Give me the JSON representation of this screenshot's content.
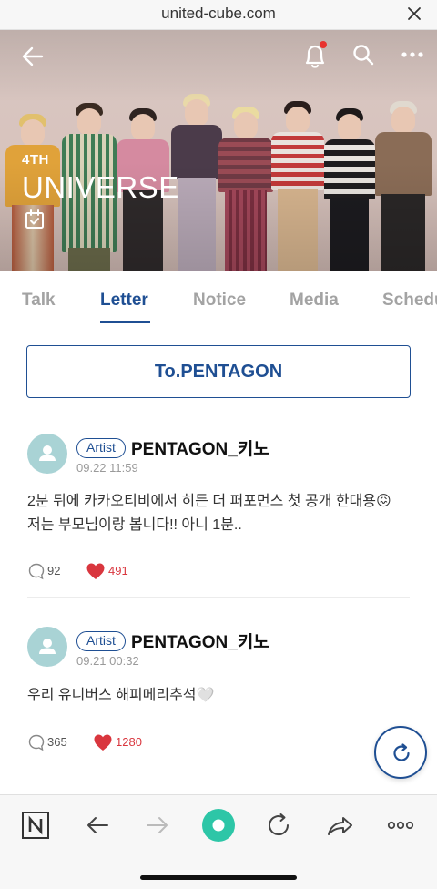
{
  "browser": {
    "url": "united-cube.com"
  },
  "hero": {
    "subtitle": "4TH",
    "title": "UNIVERSE"
  },
  "tabs": [
    {
      "label": "Talk",
      "active": false
    },
    {
      "label": "Letter",
      "active": true
    },
    {
      "label": "Notice",
      "active": false
    },
    {
      "label": "Media",
      "active": false
    },
    {
      "label": "Schedu",
      "active": false
    }
  ],
  "to_button": {
    "label": "To.PENTAGON"
  },
  "posts": [
    {
      "badge": "Artist",
      "author": "PENTAGON_키노",
      "date": "09.22 11:59",
      "content": "2분 뒤에 카카오티비에서 히든 더 퍼포먼스 첫 공개 한대용😖\n저는 부모님이랑 봅니다!! 아니 1분..",
      "comments": "92",
      "likes": "491"
    },
    {
      "badge": "Artist",
      "author": "PENTAGON_키노",
      "date": "09.21 00:32",
      "content": "우리 유니버스 해피메리추석🤍",
      "comments": "365",
      "likes": "1280"
    }
  ],
  "colors": {
    "accent": "#1f4f93",
    "like": "#d9363e",
    "avatar": "#a9d3d5",
    "notification_dot": "#e8322e"
  },
  "icons": {
    "back": "arrow-left-icon",
    "notification": "bell-icon",
    "search": "search-icon",
    "more": "more-horizontal-icon",
    "calendar": "calendar-check-icon",
    "comment": "comment-bubble-icon",
    "like": "heart-icon",
    "refresh": "refresh-icon"
  }
}
